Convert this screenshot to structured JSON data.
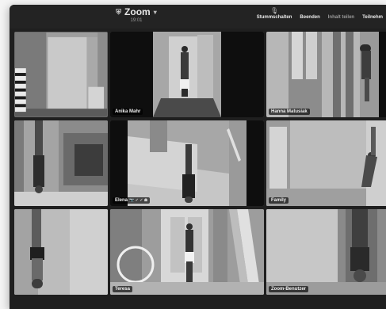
{
  "window": {
    "title": "Zoom",
    "subtitle": "19:01"
  },
  "toolbar": {
    "controls": [
      {
        "label": "Stummschalten",
        "icon": "microphone-icon"
      },
      {
        "label": "Beenden",
        "icon": "end-icon"
      },
      {
        "label": "Inhalt teilen",
        "icon": "share-icon"
      },
      {
        "label": "Teilnehm",
        "icon": "participants-icon"
      }
    ]
  },
  "participants": [
    {
      "name": ""
    },
    {
      "name": "Anika Mahr"
    },
    {
      "name": "Hanna Matusiak"
    },
    {
      "name": ""
    },
    {
      "name": "Elena",
      "status": "📷 ✓ ✓ ☗"
    },
    {
      "name": "Family"
    },
    {
      "name": ""
    },
    {
      "name": "Teresa"
    },
    {
      "name": "Zoom-Benutzer"
    }
  ]
}
